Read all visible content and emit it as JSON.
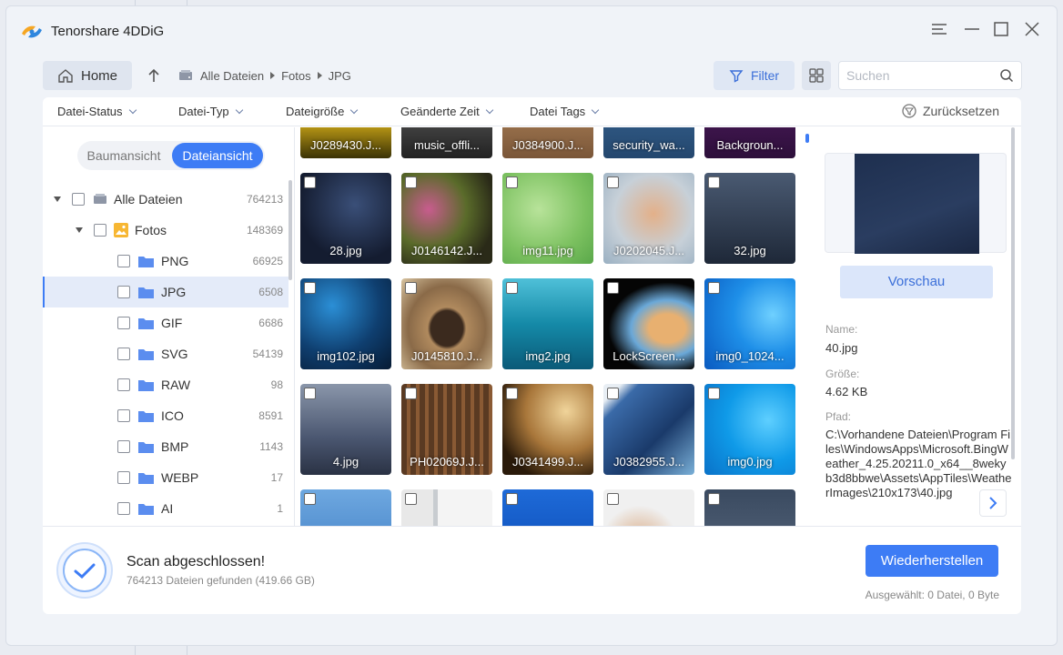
{
  "app": {
    "title": "Tenorshare 4DDiG"
  },
  "toolbar": {
    "home_label": "Home",
    "breadcrumb": [
      "Alle Dateien",
      "Fotos",
      "JPG"
    ],
    "filter_label": "Filter",
    "search_placeholder": "Suchen"
  },
  "filters": {
    "items": [
      "Datei-Status",
      "Datei-Typ",
      "Dateigröße",
      "Geänderte Zeit",
      "Datei Tags"
    ],
    "reset_label": "Zurücksetzen"
  },
  "sidebar": {
    "view_tree": "Baumansicht",
    "view_file": "Dateiansicht",
    "tree": [
      {
        "label": "Alle Dateien",
        "count": "764213"
      },
      {
        "label": "Fotos",
        "count": "148369"
      },
      {
        "label": "PNG",
        "count": "66925"
      },
      {
        "label": "JPG",
        "count": "6508"
      },
      {
        "label": "GIF",
        "count": "6686"
      },
      {
        "label": "SVG",
        "count": "54139"
      },
      {
        "label": "RAW",
        "count": "98"
      },
      {
        "label": "ICO",
        "count": "8591"
      },
      {
        "label": "BMP",
        "count": "1143"
      },
      {
        "label": "WEBP",
        "count": "17"
      },
      {
        "label": "AI",
        "count": "1"
      }
    ]
  },
  "gallery": {
    "top_row": [
      "J0289430.J...",
      "music_offli...",
      "J0384900.J...",
      "security_wa...",
      "Backgroun..."
    ],
    "rows": [
      [
        "28.jpg",
        "J0146142.J...",
        "img11.jpg",
        "J0202045.J...",
        "32.jpg"
      ],
      [
        "img102.jpg",
        "J0145810.J...",
        "img2.jpg",
        "LockScreen...",
        "img0_1024..."
      ],
      [
        "4.jpg",
        "PH02069J.J...",
        "J0341499.J...",
        "J0382955.J...",
        "img0.jpg"
      ]
    ]
  },
  "details": {
    "preview_label": "Vorschau",
    "name_label": "Name:",
    "name_value": "40.jpg",
    "size_label": "Größe:",
    "size_value": "4.62 KB",
    "path_label": "Pfad:",
    "path_value": "C:\\Vorhandene Dateien\\Program Files\\WindowsApps\\Microsoft.BingWeather_4.25.20211.0_x64__8wekyb3d8bbwe\\Assets\\AppTiles\\WeatherImages\\210x173\\40.jpg"
  },
  "footer": {
    "status": "Scan abgeschlossen!",
    "found": "764213 Dateien gefunden (419.66 GB)",
    "recover_label": "Wiederherstellen",
    "selected": "Ausgewählt: 0 Datei, 0 Byte"
  },
  "colors": {
    "accent": "#3d7cf5",
    "background": "#f0f3f8"
  }
}
